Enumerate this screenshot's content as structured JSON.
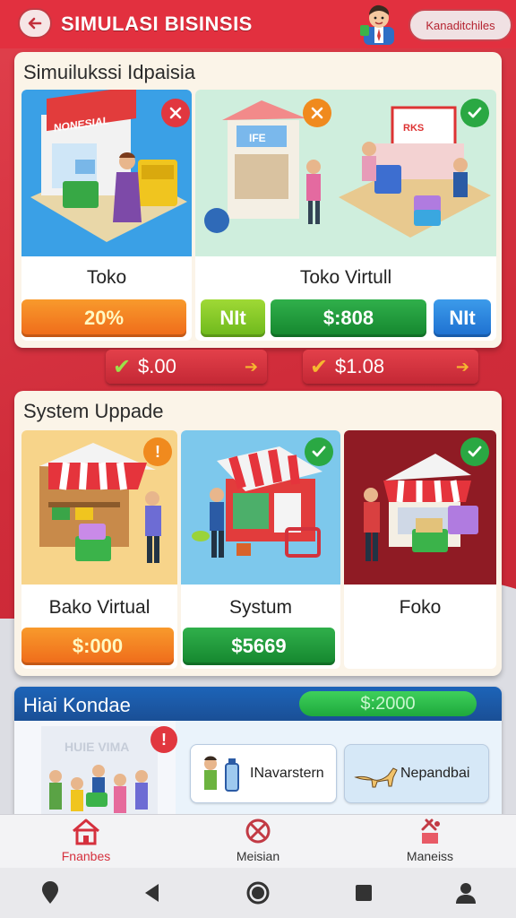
{
  "header": {
    "title": "SIMULASI BISINSIS",
    "account_label": "Kanaditchiles",
    "icons": [
      "arrow-left-icon",
      "avatar-icon"
    ]
  },
  "panel1": {
    "title": "Simuilukssi Idpaisia",
    "cards": [
      {
        "label": "Toko",
        "sign": "NONESIAL",
        "price": "20%",
        "status": "cancel"
      },
      {
        "label": "Toko Virtull",
        "sign": "IFE",
        "sign2": "RKS",
        "tags": [
          "NIt",
          "$:808",
          "NIt"
        ],
        "status": "check"
      }
    ],
    "price_tags": [
      "$.00",
      "$1.08"
    ]
  },
  "panel2": {
    "title": "System Uppade",
    "cards": [
      {
        "label": "Bako Virtual",
        "price": "$:000",
        "status": "info"
      },
      {
        "label": "Systum",
        "price": "$5669",
        "status": "check"
      },
      {
        "label": "Foko",
        "status": "check"
      }
    ]
  },
  "hari": {
    "title": "Hiai Kondae",
    "amount": "$:2000",
    "sign": "HUIE VIMA",
    "chips": [
      "INavarstern",
      "Nepandbai"
    ]
  },
  "tabs": [
    {
      "label": "Fnanbes",
      "icon": "home-icon"
    },
    {
      "label": "Meisian",
      "icon": "mission-icon"
    },
    {
      "label": "Maneiss",
      "icon": "manage-icon"
    }
  ],
  "colors": {
    "primary": "#e2303f",
    "accent_green": "#2aa843",
    "accent_orange": "#f08a1e",
    "accent_blue": "#1d64b8"
  }
}
